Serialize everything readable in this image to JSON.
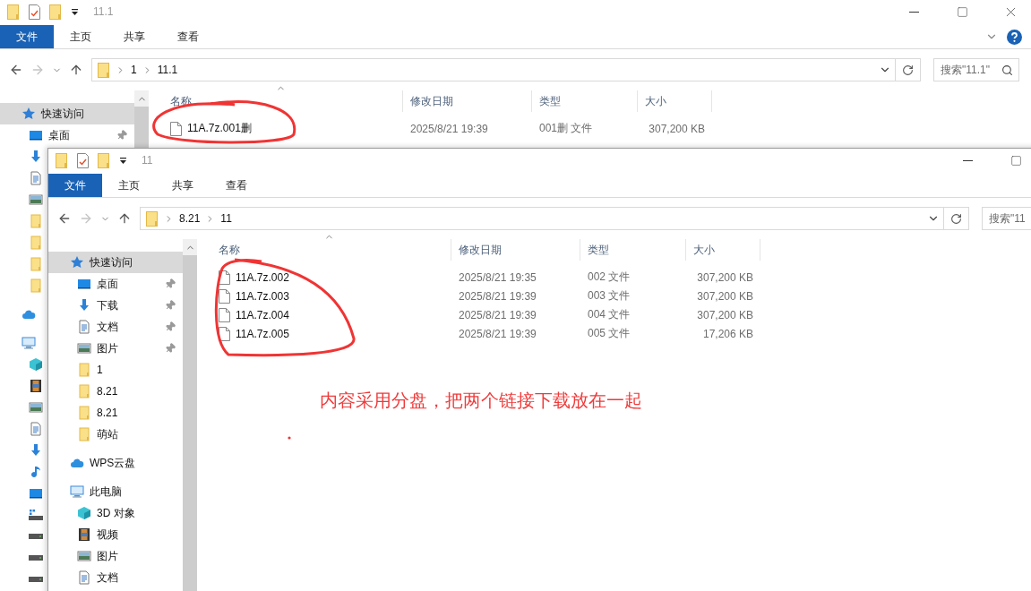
{
  "windows": [
    {
      "title": "11.1",
      "title_buttons": [
        {
          "kind": "minimize"
        },
        {
          "kind": "maximize"
        },
        {
          "kind": "close"
        }
      ],
      "ribbon_tabs": [
        {
          "label": "文件",
          "selected": true
        },
        {
          "label": "主页",
          "selected": false
        },
        {
          "label": "共享",
          "selected": false
        },
        {
          "label": "查看",
          "selected": false
        }
      ],
      "ribbon_extras": [
        {
          "kind": "collapse"
        },
        {
          "kind": "help"
        }
      ],
      "path": [
        "1",
        "11.1"
      ],
      "search": {
        "placeholder": "搜索\"11.1\""
      },
      "nav": [
        {
          "label": "快速访问",
          "kind": "star",
          "selected": true,
          "children": [
            {
              "label": "桌面",
              "kind": "desktop",
              "selected": false,
              "pinned": true
            },
            {
              "kind": "download",
              "selected": false
            },
            {
              "kind": "document",
              "selected": false
            },
            {
              "kind": "picture",
              "selected": false
            },
            {
              "kind": "folder",
              "selected": false
            },
            {
              "kind": "folder",
              "selected": false
            },
            {
              "kind": "folder",
              "selected": false
            },
            {
              "kind": "folder",
              "selected": false
            }
          ]
        },
        {
          "kind": "cloud",
          "selected": false
        },
        {
          "kind": "computer",
          "selected": false,
          "children": [
            {
              "kind": "cube",
              "selected": false
            },
            {
              "kind": "film",
              "selected": false
            },
            {
              "kind": "picture",
              "selected": false
            },
            {
              "kind": "document",
              "selected": false
            },
            {
              "kind": "download",
              "selected": false
            },
            {
              "kind": "music",
              "selected": false
            },
            {
              "kind": "desktop",
              "selected": false
            },
            {
              "kind": "system-drive",
              "selected": false
            },
            {
              "kind": "drive",
              "selected": false
            },
            {
              "kind": "drive",
              "selected": false
            },
            {
              "kind": "drive",
              "selected": false
            }
          ]
        }
      ],
      "columns": [
        "名称",
        "修改日期",
        "类型",
        "大小"
      ],
      "files": [
        {
          "name": "11A.7z.001删",
          "modified": "2025/8/21 19:39",
          "type": "001删 文件",
          "size": "307,200 KB"
        }
      ]
    },
    {
      "title": "11",
      "title_buttons": [
        {
          "kind": "minimize"
        },
        {
          "kind": "maximize"
        }
      ],
      "ribbon_tabs": [
        {
          "label": "文件",
          "selected": true
        },
        {
          "label": "主页",
          "selected": false
        },
        {
          "label": "共享",
          "selected": false
        },
        {
          "label": "查看",
          "selected": false
        }
      ],
      "path": [
        "8.21",
        "11"
      ],
      "search": {
        "placeholder": "搜索\"11"
      },
      "nav": [
        {
          "label": "快速访问",
          "kind": "star",
          "selected": true,
          "children": [
            {
              "label": "桌面",
              "kind": "desktop",
              "selected": false,
              "pinned": true
            },
            {
              "label": "下载",
              "kind": "download",
              "selected": false,
              "pinned": true
            },
            {
              "label": "文档",
              "kind": "document",
              "selected": false,
              "pinned": true
            },
            {
              "label": "图片",
              "kind": "picture",
              "selected": false,
              "pinned": true
            },
            {
              "label": "1",
              "kind": "folder",
              "selected": false,
              "pinned": false
            },
            {
              "label": "8.21",
              "kind": "folder",
              "selected": false,
              "pinned": false
            },
            {
              "label": "8.21",
              "kind": "folder",
              "selected": false,
              "pinned": false
            },
            {
              "label": "萌站",
              "kind": "folder",
              "selected": false,
              "pinned": false
            }
          ]
        },
        {
          "label": "WPS云盘",
          "kind": "cloud",
          "selected": false
        },
        {
          "label": "此电脑",
          "kind": "computer",
          "selected": false,
          "children": [
            {
              "label": "3D 对象",
              "kind": "cube",
              "selected": false
            },
            {
              "label": "视频",
              "kind": "film",
              "selected": false
            },
            {
              "label": "图片",
              "kind": "picture",
              "selected": false
            },
            {
              "label": "文档",
              "kind": "document",
              "selected": false
            }
          ]
        }
      ],
      "columns": [
        "名称",
        "修改日期",
        "类型",
        "大小"
      ],
      "files": [
        {
          "name": "11A.7z.002",
          "modified": "2025/8/21 19:35",
          "type": "002 文件",
          "size": "307,200 KB"
        },
        {
          "name": "11A.7z.003",
          "modified": "2025/8/21 19:39",
          "type": "003 文件",
          "size": "307,200 KB"
        },
        {
          "name": "11A.7z.004",
          "modified": "2025/8/21 19:39",
          "type": "004 文件",
          "size": "307,200 KB"
        },
        {
          "name": "11A.7z.005",
          "modified": "2025/8/21 19:39",
          "type": "005 文件",
          "size": "17,206 KB"
        }
      ]
    }
  ],
  "annotation": {
    "note": "内容采用分盘，把两个链接下载放在一起"
  }
}
